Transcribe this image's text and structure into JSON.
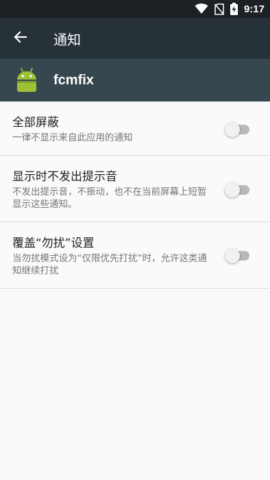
{
  "status_bar": {
    "time": "9:17",
    "icons": [
      "wifi-icon",
      "no-sim-icon",
      "battery-charging-icon"
    ]
  },
  "toolbar": {
    "back_icon": "arrow-back-icon",
    "title": "通知"
  },
  "app_header": {
    "icon": "android-icon",
    "name": "fcmfix",
    "icon_color": "#9fc037"
  },
  "preferences": [
    {
      "title": "全部屏蔽",
      "summary": "一律不显示来自此应用的通知",
      "enabled": false
    },
    {
      "title": "显示时不发出提示音",
      "summary": "不发出提示音，不振动，也不在当前屏幕上短暂显示这些通知。",
      "enabled": false
    },
    {
      "title": "覆盖“勿扰”设置",
      "summary": "当勿扰模式设为“仅限优先打扰”时，允许这类通知继续打扰",
      "enabled": false
    }
  ],
  "colors": {
    "status_bar": "#1b2125",
    "toolbar": "#263238",
    "app_header": "#37474f",
    "background": "#fafafa"
  }
}
